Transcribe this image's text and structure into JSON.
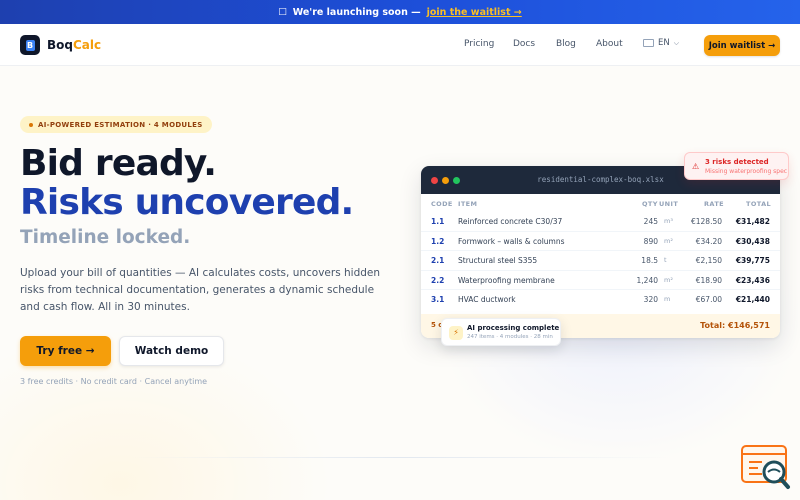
{
  "announcement": {
    "icon": "rocket-icon",
    "text": "We're launching soon —",
    "cta": "join the waitlist →"
  },
  "nav": {
    "brand_part1": "Boq",
    "brand_part2": "Calc",
    "links": [
      "Pricing",
      "Docs",
      "Blog",
      "About"
    ],
    "language": "EN",
    "join_label": "Join waitlist →"
  },
  "hero": {
    "badge": "AI-POWERED ESTIMATION · 4 MODULES",
    "line1": "Bid ready.",
    "line2": "Risks uncovered.",
    "line3": "Timeline locked.",
    "description": "Upload your bill of quantities — AI calculates costs, uncovers hidden risks from technical documentation, generates a dynamic schedule and cash flow. All in 30 minutes.",
    "primary_cta": "Try free →",
    "secondary_cta": "Watch demo",
    "fineprint": "3 free credits · No credit card · Cancel anytime"
  },
  "sheet": {
    "filename": "residential-complex-boq.xlsx",
    "headers": {
      "code": "CODE",
      "item": "ITEM",
      "qty": "QTY",
      "unit": "UNIT",
      "rate": "RATE",
      "total": "TOTAL"
    },
    "rows": [
      {
        "code": "1.1",
        "item": "Reinforced concrete C30/37",
        "qty": "245",
        "unit": "m³",
        "rate": "€128.50",
        "total": "€31,482"
      },
      {
        "code": "1.2",
        "item": "Formwork – walls & columns",
        "qty": "890",
        "unit": "m²",
        "rate": "€34.20",
        "total": "€30,438"
      },
      {
        "code": "2.1",
        "item": "Structural steel S355",
        "qty": "18.5",
        "unit": "t",
        "rate": "€2,150",
        "total": "€39,775"
      },
      {
        "code": "2.2",
        "item": "Waterproofing membrane",
        "qty": "1,240",
        "unit": "m²",
        "rate": "€18.90",
        "total": "€23,436"
      },
      {
        "code": "3.1",
        "item": "HVAC ductwork",
        "qty": "320",
        "unit": "m",
        "rate": "€67.00",
        "total": "€21,440"
      }
    ],
    "footer_count": "5 c",
    "footer_total": "Total: €146,571"
  },
  "risk_toast": {
    "title": "3 risks detected",
    "subtitle": "Missing waterproofing spec"
  },
  "ai_toast": {
    "title": "AI processing complete",
    "subtitle": "247 items · 4 modules · 28 min"
  },
  "colors": {
    "accent": "#f59e0b",
    "brand_blue": "#1e40af",
    "dark": "#0f172a",
    "risk_red": "#dc2626"
  }
}
